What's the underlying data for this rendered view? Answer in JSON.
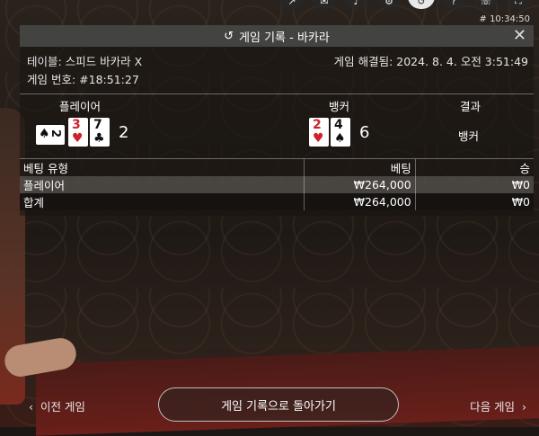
{
  "clock": "# 10:34:50",
  "top_icons": [
    "share-icon",
    "chat-icon",
    "sound-icon",
    "settings-icon",
    "history-icon",
    "help-icon",
    "phone-icon",
    "fullscreen-icon"
  ],
  "header": {
    "title": "게임 기록 - 바카라",
    "close": "✕"
  },
  "info": {
    "table_name": "테이블: 스피드 바카라 X",
    "resolved": "게임 해결됨: 2024. 8. 4. 오전 3:51:49",
    "game_no": "게임 번호: #18:51:27"
  },
  "result": {
    "player_label": "플레이어",
    "banker_label": "뱅커",
    "result_label": "결과",
    "player_cards": [
      {
        "rank": "2",
        "suit": "♠",
        "color": "black"
      },
      {
        "rank": "3",
        "suit": "♥",
        "color": "red"
      },
      {
        "rank": "7",
        "suit": "♣",
        "color": "black"
      }
    ],
    "player_score": "2",
    "banker_cards": [
      {
        "rank": "2",
        "suit": "♥",
        "color": "red"
      },
      {
        "rank": "4",
        "suit": "♠",
        "color": "black"
      }
    ],
    "banker_score": "6",
    "winner": "뱅커"
  },
  "bets": {
    "headers": [
      "베팅 유형",
      "베팅",
      "승"
    ],
    "rows": [
      [
        "플레이어",
        "₩264,000",
        "₩0"
      ],
      [
        "합계",
        "₩264,000",
        "₩0"
      ]
    ]
  },
  "footer": {
    "prev": "이전 게임",
    "back": "게임 기록으로 돌아가기",
    "next": "다음 게임"
  }
}
